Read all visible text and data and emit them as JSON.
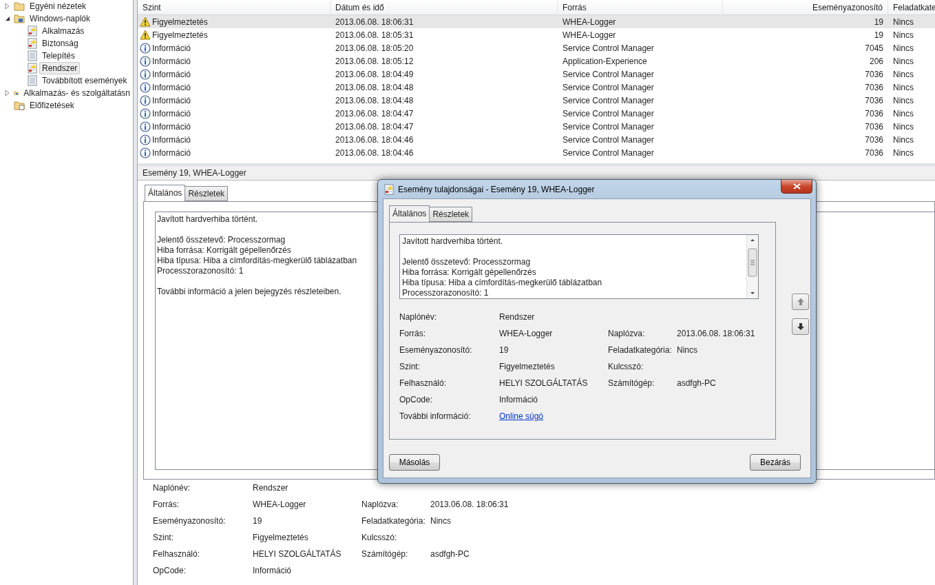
{
  "tree": [
    {
      "label": "Egyéni nézetek",
      "kind": "custom-view",
      "expanded": false,
      "selected": false
    },
    {
      "label": "Windows-naplók",
      "kind": "folder",
      "expanded": true,
      "selected": false,
      "children": [
        {
          "label": "Alkalmazás",
          "kind": "log-warning",
          "selected": false
        },
        {
          "label": "Biztonság",
          "kind": "log-warning",
          "selected": false
        },
        {
          "label": "Telepítés",
          "kind": "log",
          "selected": false
        },
        {
          "label": "Rendszer",
          "kind": "log-warning",
          "selected": true
        },
        {
          "label": "Továbbított események",
          "kind": "log",
          "selected": false
        }
      ]
    },
    {
      "label": "Alkalmazás- és szolgáltatásn",
      "kind": "folder",
      "expanded": false,
      "selected": false
    },
    {
      "label": "Előfizetések",
      "kind": "subscription",
      "selected": false
    }
  ],
  "table": {
    "columns": [
      "Szint",
      "Dátum és idő",
      "Forrás",
      "Eseményazonosító",
      "Feladatkate"
    ],
    "rows": [
      {
        "kind": "warning",
        "level": "Figyelmeztetés",
        "date": "2013.06.08. 18:06:31",
        "source": "WHEA-Logger",
        "id": "19",
        "category": "Nincs",
        "selected": true
      },
      {
        "kind": "warning",
        "level": "Figyelmeztetés",
        "date": "2013.06.08. 18:05:31",
        "source": "WHEA-Logger",
        "id": "19",
        "category": "Nincs",
        "selected": false
      },
      {
        "kind": "info",
        "level": "Információ",
        "date": "2013.06.08. 18:05:20",
        "source": "Service Control Manager",
        "id": "7045",
        "category": "Nincs",
        "selected": false
      },
      {
        "kind": "info",
        "level": "Információ",
        "date": "2013.06.08. 18:05:12",
        "source": "Application-Experience",
        "id": "206",
        "category": "Nincs",
        "selected": false
      },
      {
        "kind": "info",
        "level": "Információ",
        "date": "2013.06.08. 18:04:49",
        "source": "Service Control Manager",
        "id": "7036",
        "category": "Nincs",
        "selected": false
      },
      {
        "kind": "info",
        "level": "Információ",
        "date": "2013.06.08. 18:04:48",
        "source": "Service Control Manager",
        "id": "7036",
        "category": "Nincs",
        "selected": false
      },
      {
        "kind": "info",
        "level": "Információ",
        "date": "2013.06.08. 18:04:48",
        "source": "Service Control Manager",
        "id": "7036",
        "category": "Nincs",
        "selected": false
      },
      {
        "kind": "info",
        "level": "Információ",
        "date": "2013.06.08. 18:04:47",
        "source": "Service Control Manager",
        "id": "7036",
        "category": "Nincs",
        "selected": false
      },
      {
        "kind": "info",
        "level": "Információ",
        "date": "2013.06.08. 18:04:47",
        "source": "Service Control Manager",
        "id": "7036",
        "category": "Nincs",
        "selected": false
      },
      {
        "kind": "info",
        "level": "Információ",
        "date": "2013.06.08. 18:04:46",
        "source": "Service Control Manager",
        "id": "7036",
        "category": "Nincs",
        "selected": false
      },
      {
        "kind": "info",
        "level": "Információ",
        "date": "2013.06.08. 18:04:46",
        "source": "Service Control Manager",
        "id": "7036",
        "category": "Nincs",
        "selected": false
      }
    ]
  },
  "preview": {
    "title": "Esemény 19, WHEA-Logger",
    "tabs": [
      {
        "label": "Általános",
        "selected": true
      },
      {
        "label": "Részletek",
        "selected": false
      }
    ],
    "message": [
      "Javított hardverhiba történt.",
      "Jelentő összetevő: Processzormag\nHiba forrása: Korrigált gépellenőrzés\nHiba típusa: Hiba a címfordítás-megkerülő táblázatban\nProcesszorazonosító: 1",
      "További információ a jelen bejegyzés részleteiben."
    ],
    "details": [
      {
        "label": "Naplónév:",
        "value": "Rendszer"
      },
      {
        "label": "Forrás:",
        "value": "WHEA-Logger",
        "label2": "Naplózva:",
        "value2": "2013.06.08. 18:06:31"
      },
      {
        "label": "Eseményazonosító:",
        "value": "19",
        "label2": "Feladatkategória:",
        "value2": "Nincs"
      },
      {
        "label": "Szint:",
        "value": "Figyelmeztetés",
        "label2": "Kulcsszó:"
      },
      {
        "label": "Felhasználó:",
        "value": "HELYI SZOLGÁLTATÁS",
        "label2": "Számítógép:",
        "value2": "asdfgh-PC"
      },
      {
        "label": "OpCode:",
        "value": "Információ"
      }
    ]
  },
  "dialog": {
    "title": "Esemény tulajdonságai - Esemény 19, WHEA-Logger",
    "tabs": [
      {
        "label": "Általános",
        "selected": true
      },
      {
        "label": "Részletek",
        "selected": false
      }
    ],
    "message": [
      "Javított hardverhiba történt.",
      "Jelentő összetevő: Processzormag\nHiba forrása: Korrigált gépellenőrzés\nHiba típusa: Hiba a címfordítás-megkerülő táblázatban\nProcesszorazonosító: 1"
    ],
    "details": [
      {
        "label": "Naplónév:",
        "value": "Rendszer"
      },
      {
        "label": "Forrás:",
        "value": "WHEA-Logger",
        "label2": "Naplózva:",
        "value2": "2013.06.08. 18:06:31"
      },
      {
        "label": "Eseményazonosító:",
        "value": "19",
        "label2": "Feladatkategória:",
        "value2": "Nincs"
      },
      {
        "label": "Szint:",
        "value": "Figyelmeztetés",
        "label2": "Kulcsszó:"
      },
      {
        "label": "Felhasználó:",
        "value": "HELYI SZOLGÁLTATÁS",
        "label2": "Számítógép:",
        "value2": "asdfgh-PC"
      },
      {
        "label": "OpCode:",
        "value": "Információ"
      },
      {
        "label": "További információ:",
        "link": "Online súgó"
      }
    ],
    "buttons": [
      "Másolás",
      "Bezárás"
    ]
  }
}
